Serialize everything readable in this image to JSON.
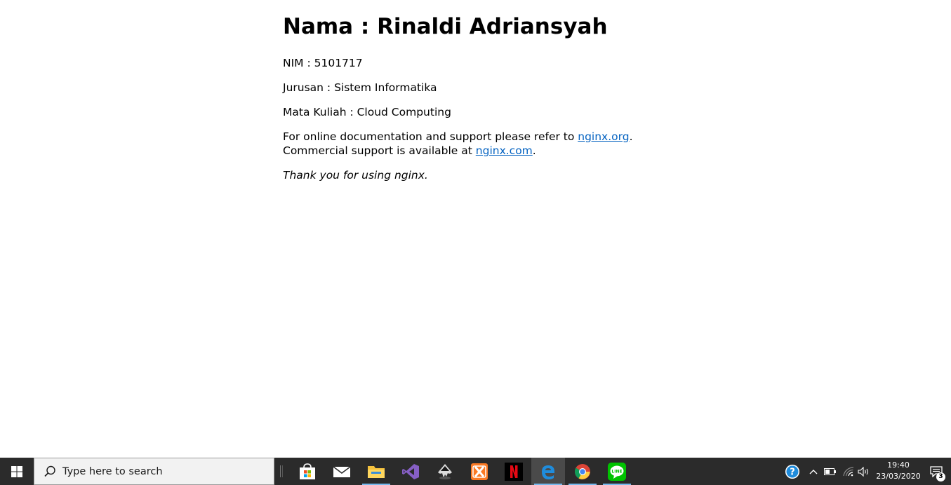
{
  "page": {
    "heading": "Nama : Rinaldi Adriansyah",
    "nim": "NIM : 5101717",
    "jurusan": "Jurusan : Sistem Informatika",
    "mata_kuliah": "Mata Kuliah : Cloud Computing",
    "doc_text_before": "For online documentation and support please refer to ",
    "doc_link": "nginx.org",
    "doc_text_after": ".",
    "commercial_text_before": "Commercial support is available at ",
    "commercial_link": "nginx.com",
    "commercial_text_after": ".",
    "thanks": "Thank you for using nginx.",
    "link_color": "#0563c1"
  },
  "taskbar": {
    "search_placeholder": "Type here to search",
    "apps": [
      {
        "name": "store-icon",
        "active": false
      },
      {
        "name": "mail-icon",
        "active": false
      },
      {
        "name": "file-explorer-icon",
        "active": false
      },
      {
        "name": "visual-studio-icon",
        "active": false
      },
      {
        "name": "inkscape-icon",
        "active": false
      },
      {
        "name": "xampp-icon",
        "active": false
      },
      {
        "name": "netflix-icon",
        "active": false
      },
      {
        "name": "edge-icon",
        "active": true
      },
      {
        "name": "chrome-icon",
        "active": false
      },
      {
        "name": "line-icon",
        "active": false
      }
    ],
    "clock_time": "19:40",
    "clock_date": "23/03/2020",
    "notification_count": "3",
    "background_color": "#2b2b2b"
  }
}
